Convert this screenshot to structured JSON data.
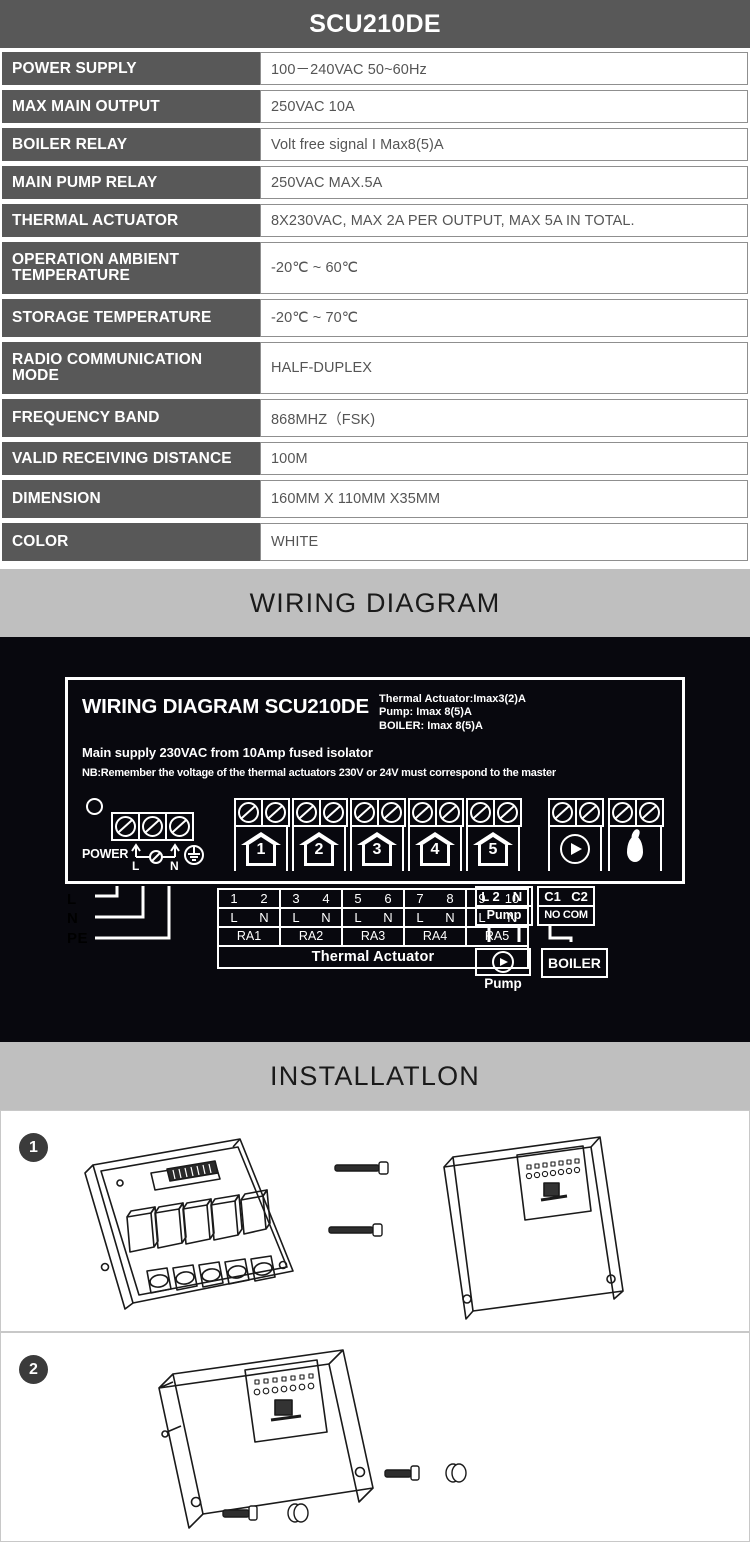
{
  "header": {
    "title": "SCU210DE"
  },
  "spec_table": {
    "rows": [
      {
        "label": "POWER SUPPLY",
        "label2": "",
        "value": "100－240VAC  50~60Hz"
      },
      {
        "label": "MAX MAIN OUTPUT",
        "label2": "",
        "value": "250VAC 10A"
      },
      {
        "label": "BOILER RELAY",
        "label2": "",
        "value": "Volt free signal  I Max8(5)A"
      },
      {
        "label": "MAIN PUMP RELAY",
        "label2": "",
        "value": "250VAC MAX.5A"
      },
      {
        "label": "THERMAL ACTUATOR",
        "label2": "",
        "value": "8X230VAC, MAX 2A PER OUTPUT, MAX 5A IN TOTAL."
      },
      {
        "label": "OPERATION AMBIENT",
        "label2": "TEMPERATURE",
        "value": "-20℃ ~ 60℃"
      },
      {
        "label": "STORAGE TEMPERATURE",
        "label2": "",
        "value": "-20℃ ~ 70℃"
      },
      {
        "label": "RADIO COMMUNICATION",
        "label2": "MODE",
        "value": "HALF-DUPLEX"
      },
      {
        "label": "FREQUENCY BAND",
        "label2": "",
        "value": "868MHZ（FSK)"
      },
      {
        "label": "VALID RECEIVING DISTANCE",
        "label2": "",
        "value": "100M"
      },
      {
        "label": "DIMENSION",
        "label2": "",
        "value": "160MM X 110MM X35MM"
      },
      {
        "label": "COLOR",
        "label2": "",
        "value": "WHITE"
      }
    ]
  },
  "wiring_section": {
    "banner": "WIRING DIAGRAM",
    "panel_title": "WIRING DIAGRAM SCU210DE",
    "ratings": [
      "Thermal Actuator:Imax3(2)A",
      "Pump: Imax 8(5)A",
      "BOILER: Imax 8(5)A"
    ],
    "note_main": "Main supply 230VAC from 10Amp fused isolator",
    "note_nb": "NB:Remember the voltage of the thermal actuators 230V or 24V must correspond to the master",
    "power_label": "POWER",
    "power_terminals": [
      "L",
      "N",
      "PE-earth"
    ],
    "supply_wires": [
      "L",
      "N",
      "PE"
    ],
    "zones": [
      "1",
      "2",
      "3",
      "4",
      "5"
    ],
    "outputs": [
      {
        "name": "pump-output",
        "icon": "pump-icon"
      },
      {
        "name": "boiler-output",
        "icon": "flame-icon"
      }
    ],
    "thermal_actuator": {
      "caption": "Thermal Actuator",
      "groups": [
        {
          "numbers": [
            "1",
            "2"
          ],
          "terminals": [
            "L",
            "N"
          ],
          "ra": "RA1"
        },
        {
          "numbers": [
            "3",
            "4"
          ],
          "terminals": [
            "L",
            "N"
          ],
          "ra": "RA2"
        },
        {
          "numbers": [
            "5",
            "6"
          ],
          "terminals": [
            "L",
            "N"
          ],
          "ra": "RA3"
        },
        {
          "numbers": [
            "7",
            "8"
          ],
          "terminals": [
            "L",
            "N"
          ],
          "ra": "RA4"
        },
        {
          "numbers": [
            "9",
            "10"
          ],
          "terminals": [
            "L",
            "N"
          ],
          "ra": "RA5"
        }
      ]
    },
    "pump_block": {
      "terminals": [
        "L 2",
        "N"
      ],
      "label": "Pump",
      "device_caption": "Pump"
    },
    "boiler_block": {
      "terminals": [
        "C1",
        "C2"
      ],
      "contacts": "NO COM",
      "device_label": "BOILER"
    }
  },
  "installation_section": {
    "banner": "INSTALLATLON",
    "steps": [
      {
        "number": "1",
        "art": "backplate-screws-cover"
      },
      {
        "number": "2",
        "art": "unit-screws-washers"
      }
    ]
  },
  "colors": {
    "header_gray": "#585858",
    "banner_gray": "#bfbfbf",
    "diagram_black": "#08080e",
    "value_text": "#555555",
    "border_gray": "#8f8f8f"
  }
}
